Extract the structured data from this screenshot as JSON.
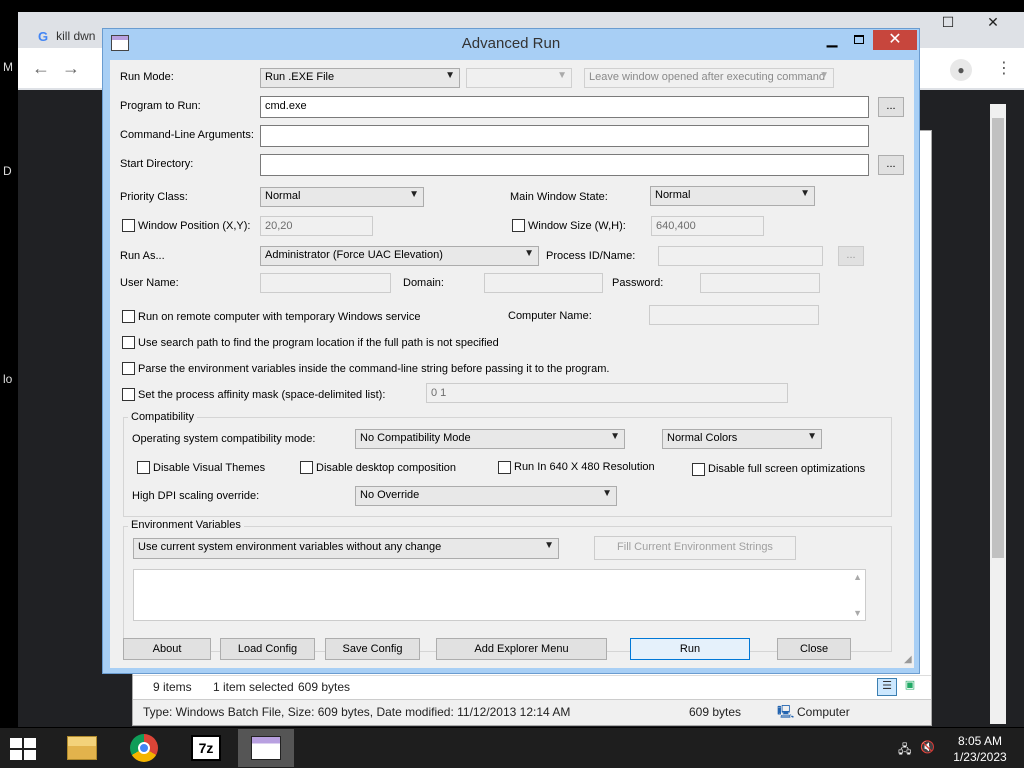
{
  "browser": {
    "tab_title": "kill dwn",
    "tab_icon": "G",
    "content_letters": [
      "M",
      "D",
      "lo"
    ]
  },
  "dialog": {
    "title": "Advanced Run",
    "run_mode": {
      "label": "Run Mode:",
      "value": "Run .EXE File",
      "second_value": "",
      "window_option": "Leave window opened after executing command"
    },
    "program": {
      "label": "Program to Run:",
      "value": "cmd.exe",
      "browse": "..."
    },
    "cmdline": {
      "label": "Command-Line Arguments:",
      "value": ""
    },
    "startdir": {
      "label": "Start Directory:",
      "value": "",
      "browse": "..."
    },
    "priority": {
      "label": "Priority Class:",
      "value": "Normal"
    },
    "main_window_state": {
      "label": "Main Window State:",
      "value": "Normal"
    },
    "window_position": {
      "label": "Window Position (X,Y):",
      "value": "20,20"
    },
    "window_size": {
      "label": "Window Size (W,H):",
      "value": "640,400"
    },
    "run_as": {
      "label": "Run As...",
      "value": "Administrator (Force UAC Elevation)"
    },
    "process_id": {
      "label": "Process ID/Name:",
      "value": "",
      "browse": "..."
    },
    "user_name": {
      "label": "User Name:",
      "value": ""
    },
    "domain": {
      "label": "Domain:",
      "value": ""
    },
    "password": {
      "label": "Password:",
      "value": ""
    },
    "remote": {
      "label": "Run on remote computer with temporary Windows service"
    },
    "computer_name": {
      "label": "Computer Name:",
      "value": ""
    },
    "search_path": {
      "label": "Use search path to find the program location if the full path is not specified"
    },
    "parse_env": {
      "label": "Parse the environment variables inside the command-line string before passing it to the program."
    },
    "affinity": {
      "label": "Set the process affinity mask (space-delimited list):",
      "value": "0 1"
    },
    "compat": {
      "group_title": "Compatibility",
      "os_mode_label": "Operating system compatibility mode:",
      "os_mode_value": "No Compatibility Mode",
      "colors_value": "Normal Colors",
      "disable_themes": "Disable Visual Themes",
      "disable_composition": "Disable desktop composition",
      "run_640": "Run In 640 X 480 Resolution",
      "disable_fullscreen": "Disable full screen optimizations",
      "dpi_label": "High DPI scaling override:",
      "dpi_value": "No Override"
    },
    "env": {
      "group_title": "Environment Variables",
      "mode_value": "Use current system environment variables without any change",
      "fill_button": "Fill Current Environment Strings"
    },
    "buttons": {
      "about": "About",
      "load": "Load Config",
      "save": "Save Config",
      "explorer": "Add Explorer Menu",
      "run": "Run",
      "close": "Close"
    }
  },
  "explorer": {
    "item_count": "9 items",
    "selection": "1 item selected",
    "selection_size": "609 bytes",
    "detail": "Type: Windows Batch File, Size: 609 bytes, Date modified: 11/12/2013 12:14 AM",
    "size": "609 bytes",
    "location": "Computer"
  },
  "taskbar": {
    "time": "8:05 AM",
    "date": "1/23/2023",
    "sevenzip_label": "7z"
  }
}
